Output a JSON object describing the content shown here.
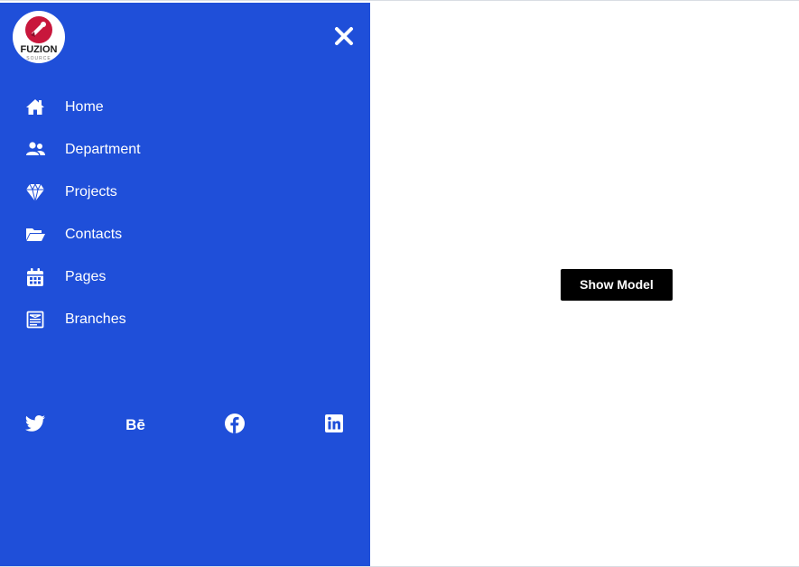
{
  "logo": {
    "brand_text": "FUZION",
    "tagline": "SOURCE",
    "icon": "fuzion-logo-icon"
  },
  "close": {
    "icon": "close-icon"
  },
  "nav": {
    "items": [
      {
        "label": "Home",
        "icon": "home-icon"
      },
      {
        "label": "Department",
        "icon": "users-icon"
      },
      {
        "label": "Projects",
        "icon": "diamond-icon"
      },
      {
        "label": "Contacts",
        "icon": "folder-open-icon"
      },
      {
        "label": "Pages",
        "icon": "calendar-icon"
      },
      {
        "label": "Branches",
        "icon": "newspaper-icon"
      }
    ]
  },
  "social": {
    "items": [
      {
        "icon": "twitter-icon"
      },
      {
        "icon": "behance-icon",
        "glyph": "Bē"
      },
      {
        "icon": "facebook-icon"
      },
      {
        "icon": "linkedin-icon"
      }
    ]
  },
  "main": {
    "show_button_label": "Show Model"
  },
  "colors": {
    "sidebar_bg": "#1f4fd9",
    "button_bg": "#000000",
    "logo_accent": "#c8173c",
    "text_on_sidebar": "#ffffff"
  }
}
